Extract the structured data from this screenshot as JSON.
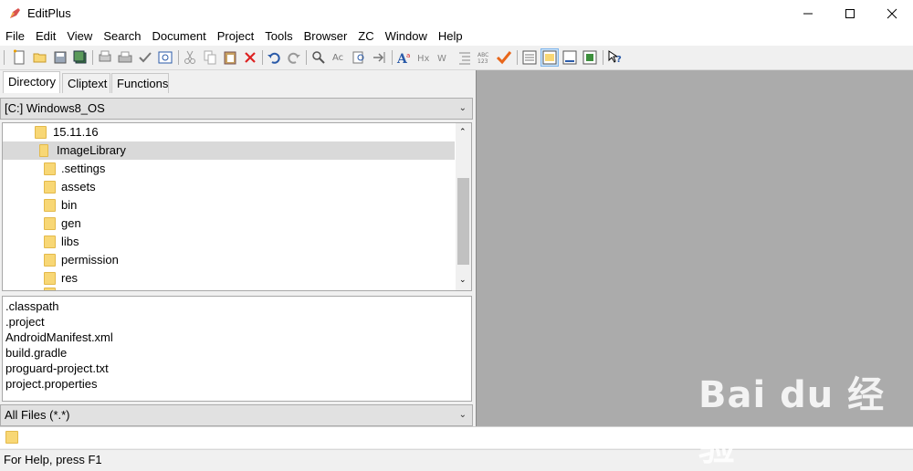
{
  "window": {
    "title": "EditPlus"
  },
  "menu": [
    "File",
    "Edit",
    "View",
    "Search",
    "Document",
    "Project",
    "Tools",
    "Browser",
    "ZC",
    "Window",
    "Help"
  ],
  "tabs": [
    "Directory",
    "Cliptext",
    "Functions"
  ],
  "drive": {
    "value": "[C:] Windows8_OS"
  },
  "tree": {
    "parent": "15.11.16",
    "selected": "ImageLibrary",
    "children": [
      ".settings",
      "assets",
      "bin",
      "gen",
      "libs",
      "permission",
      "res"
    ]
  },
  "files": [
    ".classpath",
    ".project",
    "AndroidManifest.xml",
    "build.gradle",
    "proguard-project.txt",
    "project.properties"
  ],
  "filter": {
    "value": "All Files (*.*)"
  },
  "status": {
    "text": "For Help, press F1"
  },
  "watermark": {
    "logo": "Bai du 经验",
    "url": "jingyan.baidu.com"
  },
  "colors": {
    "editor_bg": "#ababab",
    "selection": "#d9d9d9",
    "folder": "#f8d775"
  },
  "icons": [
    "new-file-icon",
    "open-icon",
    "save-icon",
    "save-all-icon",
    "print-preview-icon",
    "print-icon",
    "spellcheck-icon",
    "browser-preview-icon",
    "cut-icon",
    "copy-icon",
    "paste-icon",
    "delete-icon",
    "undo-icon",
    "redo-icon",
    "find-icon",
    "replace-icon",
    "find-in-files-icon",
    "goto-icon",
    "font-icon",
    "hex-icon",
    "word-wrap-icon",
    "indent-icon",
    "column-icon",
    "check-icon",
    "directory-window-icon",
    "cliptext-window-icon",
    "output-window-icon",
    "full-screen-icon",
    "help-icon"
  ]
}
